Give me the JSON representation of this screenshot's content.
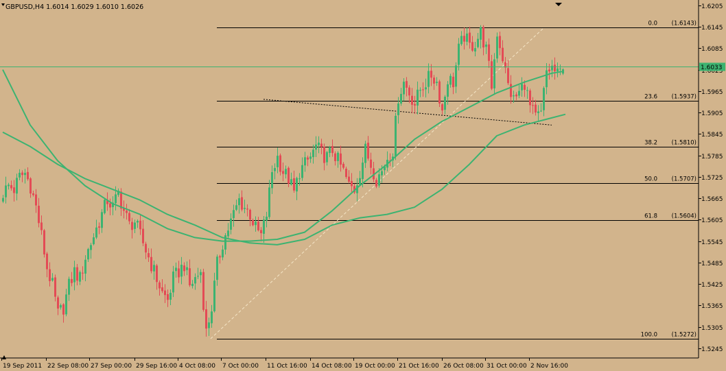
{
  "title": "GBPUSD,H4  1.6014 1.6029 1.6010 1.6026",
  "colors": {
    "background": "#d2b48c",
    "bull_candle": "#3cb371",
    "bear_candle": "#e34b55",
    "moving_average": "#3cb371",
    "bid_line": "#3cb371",
    "fibonacci": "#000000",
    "trendline": "#000000",
    "fib_diagonal": "#f5e6c8",
    "price_label_bg": "#3cb371",
    "price_label_text": "#ffffff"
  },
  "chart_data": {
    "type": "candlestick",
    "symbol": "GBPUSD",
    "timeframe": "H4",
    "ohlc_header": {
      "open": 1.6014,
      "high": 1.6029,
      "low": 1.601,
      "close": 1.6026
    },
    "current_price_label": "1.6033",
    "current_price": 1.6033,
    "ylim": [
      1.5218,
      1.622
    ],
    "y_ticks": [
      "1.6205",
      "1.6145",
      "1.6085",
      "1.6025",
      "1.5965",
      "1.5905",
      "1.5845",
      "1.5785",
      "1.5725",
      "1.5665",
      "1.5605",
      "1.5545",
      "1.5485",
      "1.5425",
      "1.5365",
      "1.5305",
      "1.5245"
    ],
    "x_ticks": [
      "19 Sep 2011",
      "22 Sep 08:00",
      "27 Sep 00:00",
      "29 Sep 16:00",
      "4 Oct 08:00",
      "7 Oct 00:00",
      "11 Oct 16:00",
      "14 Oct 08:00",
      "19 Oct 00:00",
      "21 Oct 16:00",
      "26 Oct 08:00",
      "31 Oct 00:00",
      "2 Nov 16:00"
    ],
    "grid": false,
    "fibonacci_levels": [
      {
        "level": "0.0",
        "price_label": "(1.6143)",
        "price": 1.6143
      },
      {
        "level": "23.6",
        "price_label": "(1.5937)",
        "price": 1.5937
      },
      {
        "level": "38.2",
        "price_label": "(1.5810)",
        "price": 1.581
      },
      {
        "level": "50.0",
        "price_label": "(1.5707)",
        "price": 1.5707
      },
      {
        "level": "61.8",
        "price_label": "(1.5604)",
        "price": 1.5604
      },
      {
        "level": "100.0",
        "price_label": "(1.5272)",
        "price": 1.5272
      }
    ],
    "fib_diagonal": {
      "from": [
        307,
        1.5272
      ],
      "to": [
        793,
        1.6143
      ]
    },
    "trendline": {
      "from": [
        95,
        1.5942
      ],
      "to": [
        200,
        1.587
      ]
    },
    "close_path": [
      [
        0,
        1.568
      ],
      [
        2,
        1.57
      ],
      [
        4,
        1.569
      ],
      [
        6,
        1.5725
      ],
      [
        8,
        1.5735
      ],
      [
        10,
        1.57
      ],
      [
        12,
        1.564
      ],
      [
        14,
        1.556
      ],
      [
        16,
        1.547
      ],
      [
        18,
        1.542
      ],
      [
        20,
        1.534
      ],
      [
        22,
        1.536
      ],
      [
        24,
        1.542
      ],
      [
        26,
        1.546
      ],
      [
        28,
        1.544
      ],
      [
        30,
        1.55
      ],
      [
        32,
        1.554
      ],
      [
        34,
        1.558
      ],
      [
        36,
        1.562
      ],
      [
        38,
        1.566
      ],
      [
        40,
        1.564
      ],
      [
        42,
        1.568
      ],
      [
        44,
        1.563
      ],
      [
        46,
        1.559
      ],
      [
        48,
        1.56
      ],
      [
        50,
        1.556
      ],
      [
        52,
        1.552
      ],
      [
        54,
        1.548
      ],
      [
        56,
        1.544
      ],
      [
        58,
        1.54
      ],
      [
        60,
        1.538
      ],
      [
        62,
        1.544
      ],
      [
        64,
        1.546
      ],
      [
        66,
        1.548
      ],
      [
        68,
        1.542
      ],
      [
        70,
        1.544
      ],
      [
        72,
        1.546
      ],
      [
        74,
        1.529
      ],
      [
        76,
        1.536
      ],
      [
        78,
        1.548
      ],
      [
        80,
        1.554
      ],
      [
        82,
        1.558
      ],
      [
        84,
        1.562
      ],
      [
        86,
        1.566
      ],
      [
        88,
        1.564
      ],
      [
        90,
        1.562
      ],
      [
        92,
        1.558
      ],
      [
        94,
        1.556
      ],
      [
        96,
        1.562
      ],
      [
        98,
        1.574
      ],
      [
        100,
        1.578
      ],
      [
        102,
        1.574
      ],
      [
        104,
        1.572
      ],
      [
        106,
        1.568
      ],
      [
        108,
        1.574
      ],
      [
        110,
        1.576
      ],
      [
        112,
        1.578
      ],
      [
        114,
        1.581
      ],
      [
        116,
        1.579
      ],
      [
        118,
        1.578
      ],
      [
        120,
        1.58
      ],
      [
        122,
        1.577
      ],
      [
        124,
        1.574
      ],
      [
        126,
        1.57
      ],
      [
        128,
        1.569
      ],
      [
        130,
        1.574
      ],
      [
        132,
        1.58
      ],
      [
        134,
        1.576
      ],
      [
        136,
        1.572
      ],
      [
        138,
        1.574
      ],
      [
        140,
        1.578
      ],
      [
        142,
        1.58
      ],
      [
        144,
        1.595
      ],
      [
        146,
        1.599
      ],
      [
        148,
        1.596
      ],
      [
        150,
        1.593
      ],
      [
        152,
        1.597
      ],
      [
        154,
        1.599
      ],
      [
        156,
        1.601
      ],
      [
        158,
        1.599
      ],
      [
        160,
        1.591
      ],
      [
        162,
        1.6
      ],
      [
        164,
        1.599
      ],
      [
        166,
        1.608
      ],
      [
        168,
        1.612
      ],
      [
        170,
        1.609
      ],
      [
        172,
        1.61
      ],
      [
        174,
        1.613
      ],
      [
        176,
        1.608
      ],
      [
        178,
        1.598
      ],
      [
        180,
        1.613
      ],
      [
        182,
        1.606
      ],
      [
        184,
        1.598
      ],
      [
        186,
        1.594
      ],
      [
        188,
        1.596
      ],
      [
        190,
        1.599
      ],
      [
        192,
        1.592
      ],
      [
        194,
        1.589
      ],
      [
        196,
        1.59
      ],
      [
        198,
        1.602
      ],
      [
        200,
        1.603
      ],
      [
        202,
        1.601
      ],
      [
        204,
        1.6026
      ]
    ],
    "series": [
      {
        "style": "line",
        "points": [
          [
            0,
            1.6025
          ],
          [
            10,
            1.587
          ],
          [
            20,
            1.577
          ],
          [
            30,
            1.57
          ],
          [
            40,
            1.565
          ],
          [
            50,
            1.562
          ],
          [
            60,
            1.558
          ],
          [
            70,
            1.5555
          ],
          [
            80,
            1.5545
          ],
          [
            90,
            1.5545
          ],
          [
            100,
            1.555
          ],
          [
            110,
            1.557
          ],
          [
            120,
            1.563
          ],
          [
            130,
            1.57
          ],
          [
            140,
            1.576
          ],
          [
            150,
            1.583
          ],
          [
            160,
            1.588
          ],
          [
            170,
            1.592
          ],
          [
            180,
            1.596
          ],
          [
            190,
            1.599
          ],
          [
            200,
            1.6015
          ],
          [
            204,
            1.602
          ]
        ]
      },
      {
        "style": "line",
        "points": [
          [
            0,
            1.585
          ],
          [
            10,
            1.581
          ],
          [
            20,
            1.576
          ],
          [
            30,
            1.572
          ],
          [
            40,
            1.569
          ],
          [
            50,
            1.566
          ],
          [
            60,
            1.562
          ],
          [
            70,
            1.559
          ],
          [
            80,
            1.5555
          ],
          [
            90,
            1.554
          ],
          [
            100,
            1.5535
          ],
          [
            110,
            1.555
          ],
          [
            120,
            1.559
          ],
          [
            130,
            1.561
          ],
          [
            140,
            1.562
          ],
          [
            150,
            1.564
          ],
          [
            160,
            1.569
          ],
          [
            170,
            1.576
          ],
          [
            180,
            1.584
          ],
          [
            190,
            1.587
          ],
          [
            200,
            1.589
          ],
          [
            205,
            1.59
          ]
        ]
      }
    ]
  }
}
